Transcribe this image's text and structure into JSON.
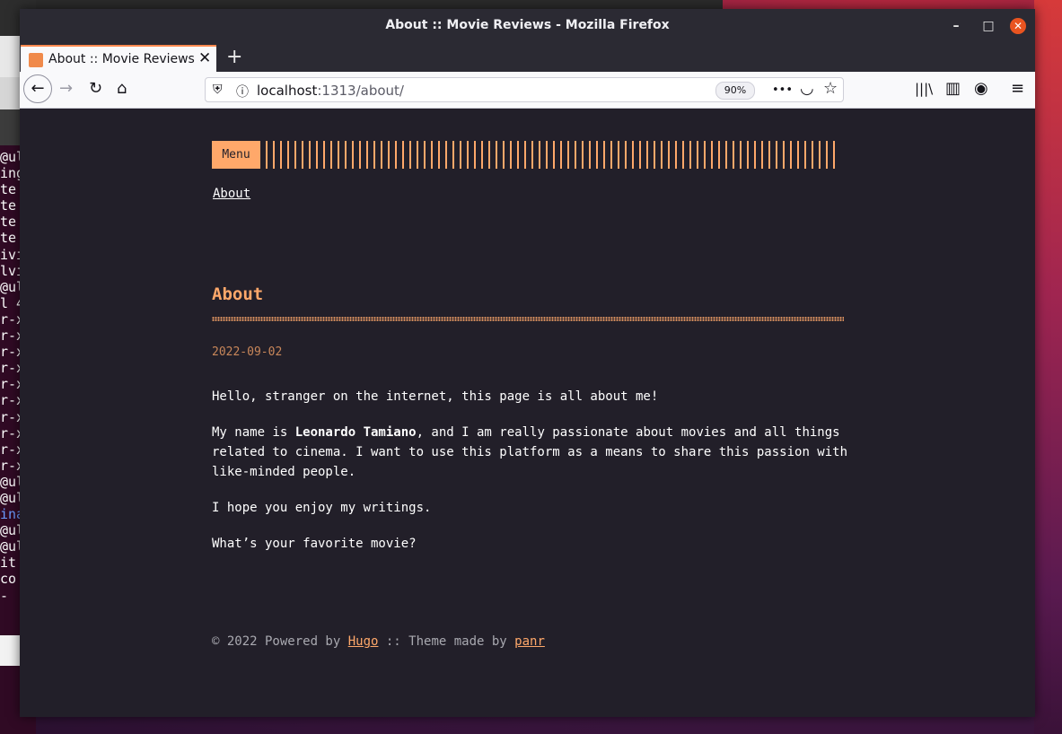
{
  "terminal": {
    "lines": [
      "@ul",
      "ing",
      "te",
      "te",
      "te",
      "te",
      "ivi",
      "lvi",
      "@ul",
      "l 4",
      "r-x",
      "r-x",
      "r-x",
      "r-x",
      "r-x",
      "r-x",
      "r-x",
      "r-x",
      "r-x",
      "r-x",
      "@ul",
      "@ul",
      "ina",
      "@ul",
      "@ul",
      "",
      "it",
      "co",
      "-"
    ]
  },
  "window": {
    "title": "About :: Movie Reviews - Mozilla Firefox",
    "minimize_label": "–",
    "maximize_label": "□",
    "close_label": "✕"
  },
  "tabs": [
    {
      "label": "About :: Movie Reviews",
      "close_label": "✕"
    }
  ],
  "newtab_label": "+",
  "navbar": {
    "back_icon": "←",
    "forward_icon": "→",
    "reload_icon": "↻",
    "home_icon": "⌂",
    "url_host": "localhost",
    "url_rest": ":1313/about/",
    "zoom": "90%",
    "more_icon": "•••",
    "pocket_icon": "◡",
    "star_icon": "☆",
    "library_icon": "|||\\",
    "sidebar_icon": "▥",
    "account_icon": "◉",
    "menu_icon": "≡"
  },
  "page": {
    "menu_label": "Menu",
    "nav_link": "About",
    "title": "About",
    "date": "2022-09-02",
    "p1": "Hello, stranger on the internet, this page is all about me!",
    "p2_before": "My name is ",
    "p2_bold": "Leonardo Tamiano",
    "p2_after": ", and I am really passionate about movies and all things related to cinema. I want to use this platform as a means to share this passion with like-minded people.",
    "p3": "I hope you enjoy my writings.",
    "p4": "What’s your favorite movie?",
    "footer_prefix": "© 2022 Powered by ",
    "footer_hugo": "Hugo",
    "footer_mid": " :: Theme made by ",
    "footer_panr": "panr"
  },
  "colors": {
    "accent": "#ffa86a",
    "page_bg": "#221f29",
    "titlebar_bg": "#2b2a33",
    "close_button": "#e95420"
  }
}
